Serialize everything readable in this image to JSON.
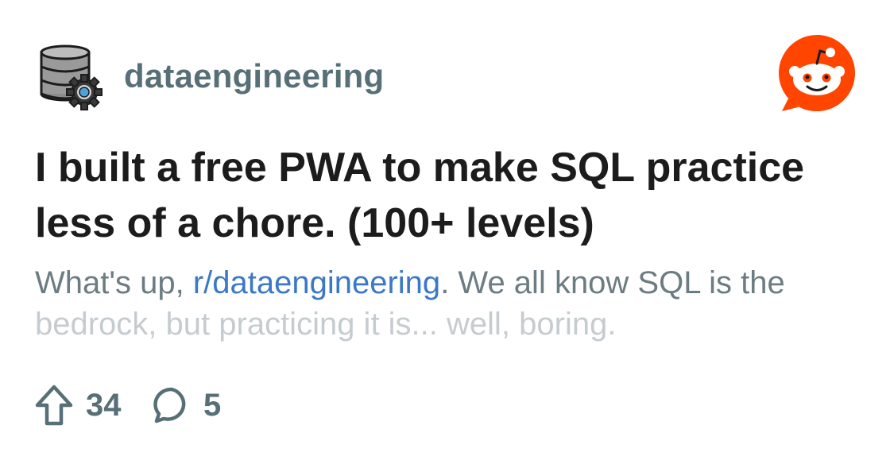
{
  "subreddit": {
    "name": "dataengineering",
    "icon": "database-gear-icon"
  },
  "brand": {
    "logo": "reddit-snoo-logo",
    "color": "#ff4500"
  },
  "post": {
    "title": "I built a free PWA to make SQL practice less of a chore. (100+ levels)",
    "body_prefix": "What's up, ",
    "body_link": "r/dataengineering",
    "body_suffix": ". We all know SQL is the",
    "body_faded": "bedrock, but practicing it is... well, boring."
  },
  "stats": {
    "upvotes": "34",
    "comments": "5",
    "upvote_icon": "upvote-arrow-icon",
    "comment_icon": "comment-bubble-icon"
  },
  "colors": {
    "link": "#3b78c6",
    "muted": "#576f76",
    "title": "#1c1c1c"
  }
}
